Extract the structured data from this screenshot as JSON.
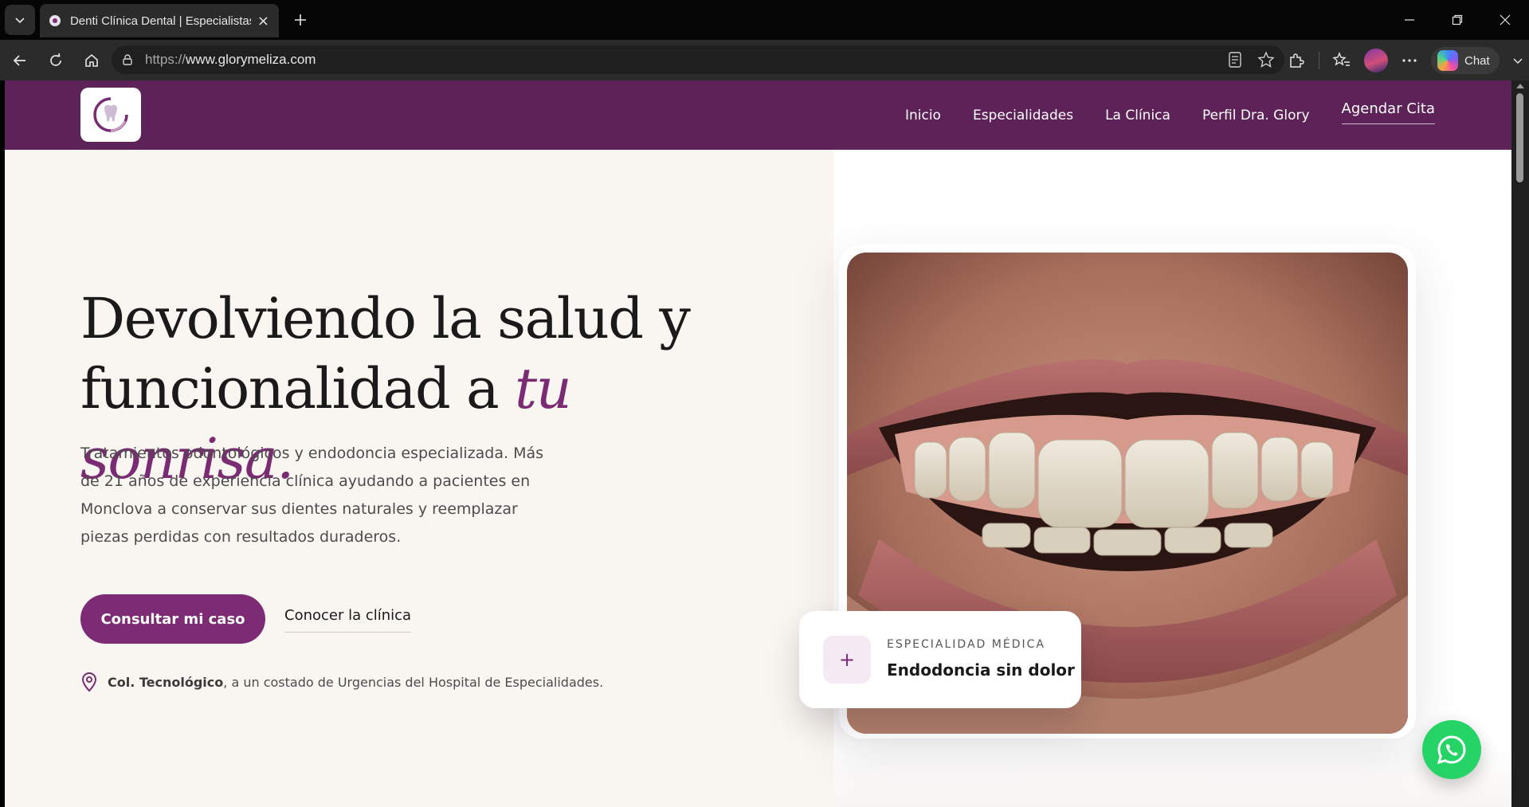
{
  "browser": {
    "tab_title": "Denti Clínica Dental | Especialistas",
    "url_scheme": "https://",
    "url_host": "www.glorymeliza.com",
    "chat_label": "Chat"
  },
  "site": {
    "nav": [
      "Inicio",
      "Especialidades",
      "La Clínica",
      "Perfil Dra. Glory"
    ],
    "cta": "Agendar Cita",
    "brand_color": "#5d2257",
    "accent_color": "#7c2b74"
  },
  "hero": {
    "headline_line1": "Devolviendo la salud y",
    "headline_line2_plain": "funcionalidad a ",
    "headline_line2_accent": "tu sonrisa.",
    "lead": "Tratamientos odontológicos y endodoncia especializada. Más de 21 años de experiencia clínica ayudando a pacientes en Monclova a conservar sus dientes naturales y reemplazar piezas perdidas con resultados duraderos.",
    "primary_button": "Consultar mi caso",
    "secondary_link": "Conocer la clínica",
    "address_bold": "Col. Tecnológico",
    "address_rest": ", a un costado de Urgencias del Hospital de Especialidades."
  },
  "badge": {
    "kicker": "ESPECIALIDAD MÉDICA",
    "title": "Endodoncia sin dolor",
    "icon_glyph": "+"
  }
}
